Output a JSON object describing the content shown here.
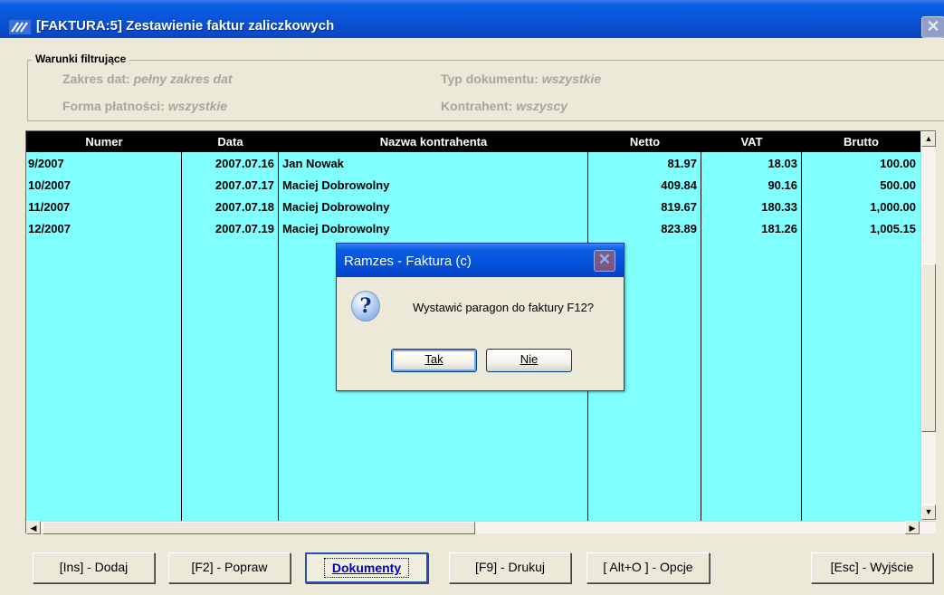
{
  "window": {
    "title": "[FAKTURA:5]  Zestawienie faktur zaliczkowych",
    "close_glyph": "✕"
  },
  "filters": {
    "legend": "Warunki filtrujące",
    "date_range_label": "Zakres dat:",
    "date_range_value": "pełny zakres dat",
    "doc_type_label": "Typ dokumentu:",
    "doc_type_value": "wszystkie",
    "payment_label": "Forma płatności:",
    "payment_value": "wszystkie",
    "contractor_label": "Kontrahent:",
    "contractor_value": "wszyscy"
  },
  "table": {
    "columns": [
      "Numer",
      "Data",
      "Nazwa kontrahenta",
      "Netto",
      "VAT",
      "Brutto"
    ],
    "rows": [
      {
        "numer": "9/2007",
        "data": "2007.07.16",
        "nazwa": "Jan Nowak",
        "netto": "81.97",
        "vat": "18.03",
        "brutto": "100.00"
      },
      {
        "numer": "10/2007",
        "data": "2007.07.17",
        "nazwa": "Maciej Dobrowolny",
        "netto": "409.84",
        "vat": "90.16",
        "brutto": "500.00"
      },
      {
        "numer": "11/2007",
        "data": "2007.07.18",
        "nazwa": "Maciej Dobrowolny",
        "netto": "819.67",
        "vat": "180.33",
        "brutto": "1,000.00"
      },
      {
        "numer": "12/2007",
        "data": "2007.07.19",
        "nazwa": "Maciej Dobrowolny",
        "netto": "823.89",
        "vat": "181.26",
        "brutto": "1,005.15"
      }
    ]
  },
  "scroll": {
    "up": "▲",
    "down": "▼",
    "left": "◀",
    "right": "▶"
  },
  "toolbar": {
    "add": "[Ins] - Dodaj",
    "edit": "[F2] - Popraw",
    "documents": "Dokumenty",
    "print": "[F9] - Drukuj",
    "options": "[ Alt+O ] - Opcje",
    "exit": "[Esc] - Wyjście"
  },
  "dialog": {
    "title": "Ramzes - Faktura (c)",
    "close_glyph": "✕",
    "icon_glyph": "?",
    "message": "Wystawić paragon do faktury F12?",
    "yes": "Tak",
    "no": "Nie"
  },
  "colors": {
    "title_bar": "#0a53d4",
    "grid_background": "#80ffff",
    "grid_header": "#000000",
    "window_background": "#ece9d8"
  }
}
